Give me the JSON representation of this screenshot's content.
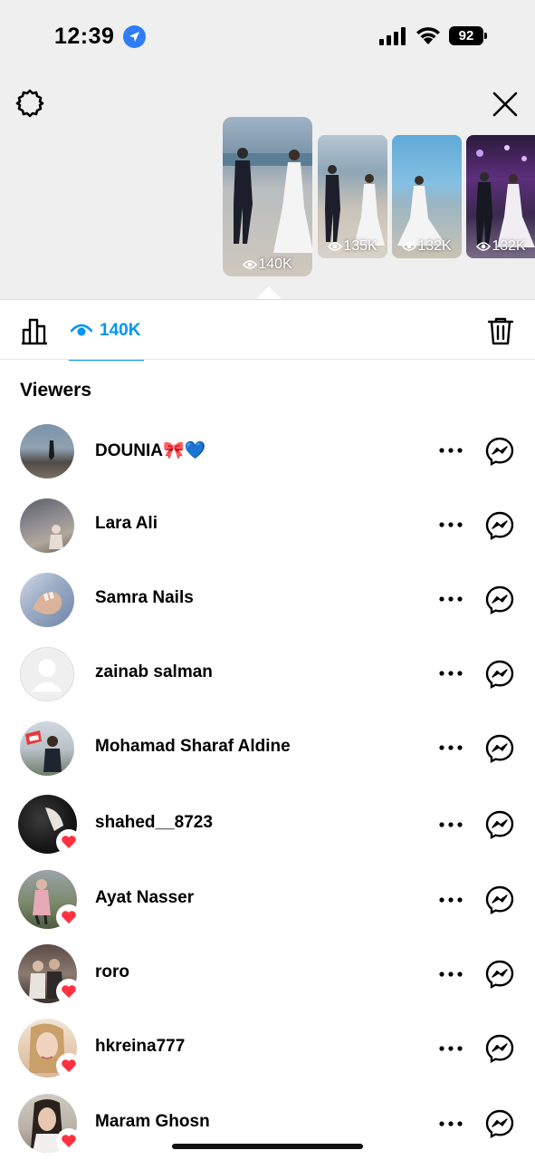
{
  "status_bar": {
    "time": "12:39",
    "battery": "92"
  },
  "stories": [
    {
      "views": "140K",
      "selected": true
    },
    {
      "views": "135K"
    },
    {
      "views": "132K"
    },
    {
      "views": "132K"
    }
  ],
  "tabs": {
    "views_count": "140K"
  },
  "viewers_title": "Viewers",
  "viewers": [
    {
      "name": "DOUNIA🎀💙",
      "liked": false
    },
    {
      "name": "Lara Ali",
      "liked": false
    },
    {
      "name": "Samra Nails",
      "liked": false
    },
    {
      "name": "zainab salman",
      "liked": false
    },
    {
      "name": "Mohamad Sharaf Aldine",
      "liked": false
    },
    {
      "name": "shahed__8723",
      "liked": true
    },
    {
      "name": "Ayat Nasser",
      "liked": true
    },
    {
      "name": "roro",
      "liked": true
    },
    {
      "name": "hkreina777",
      "liked": true
    },
    {
      "name": "Maram Ghosn",
      "liked": true
    }
  ],
  "colors": {
    "accent": "#0095f6",
    "heart": "#ff3040",
    "top_bg": "#efefef"
  }
}
